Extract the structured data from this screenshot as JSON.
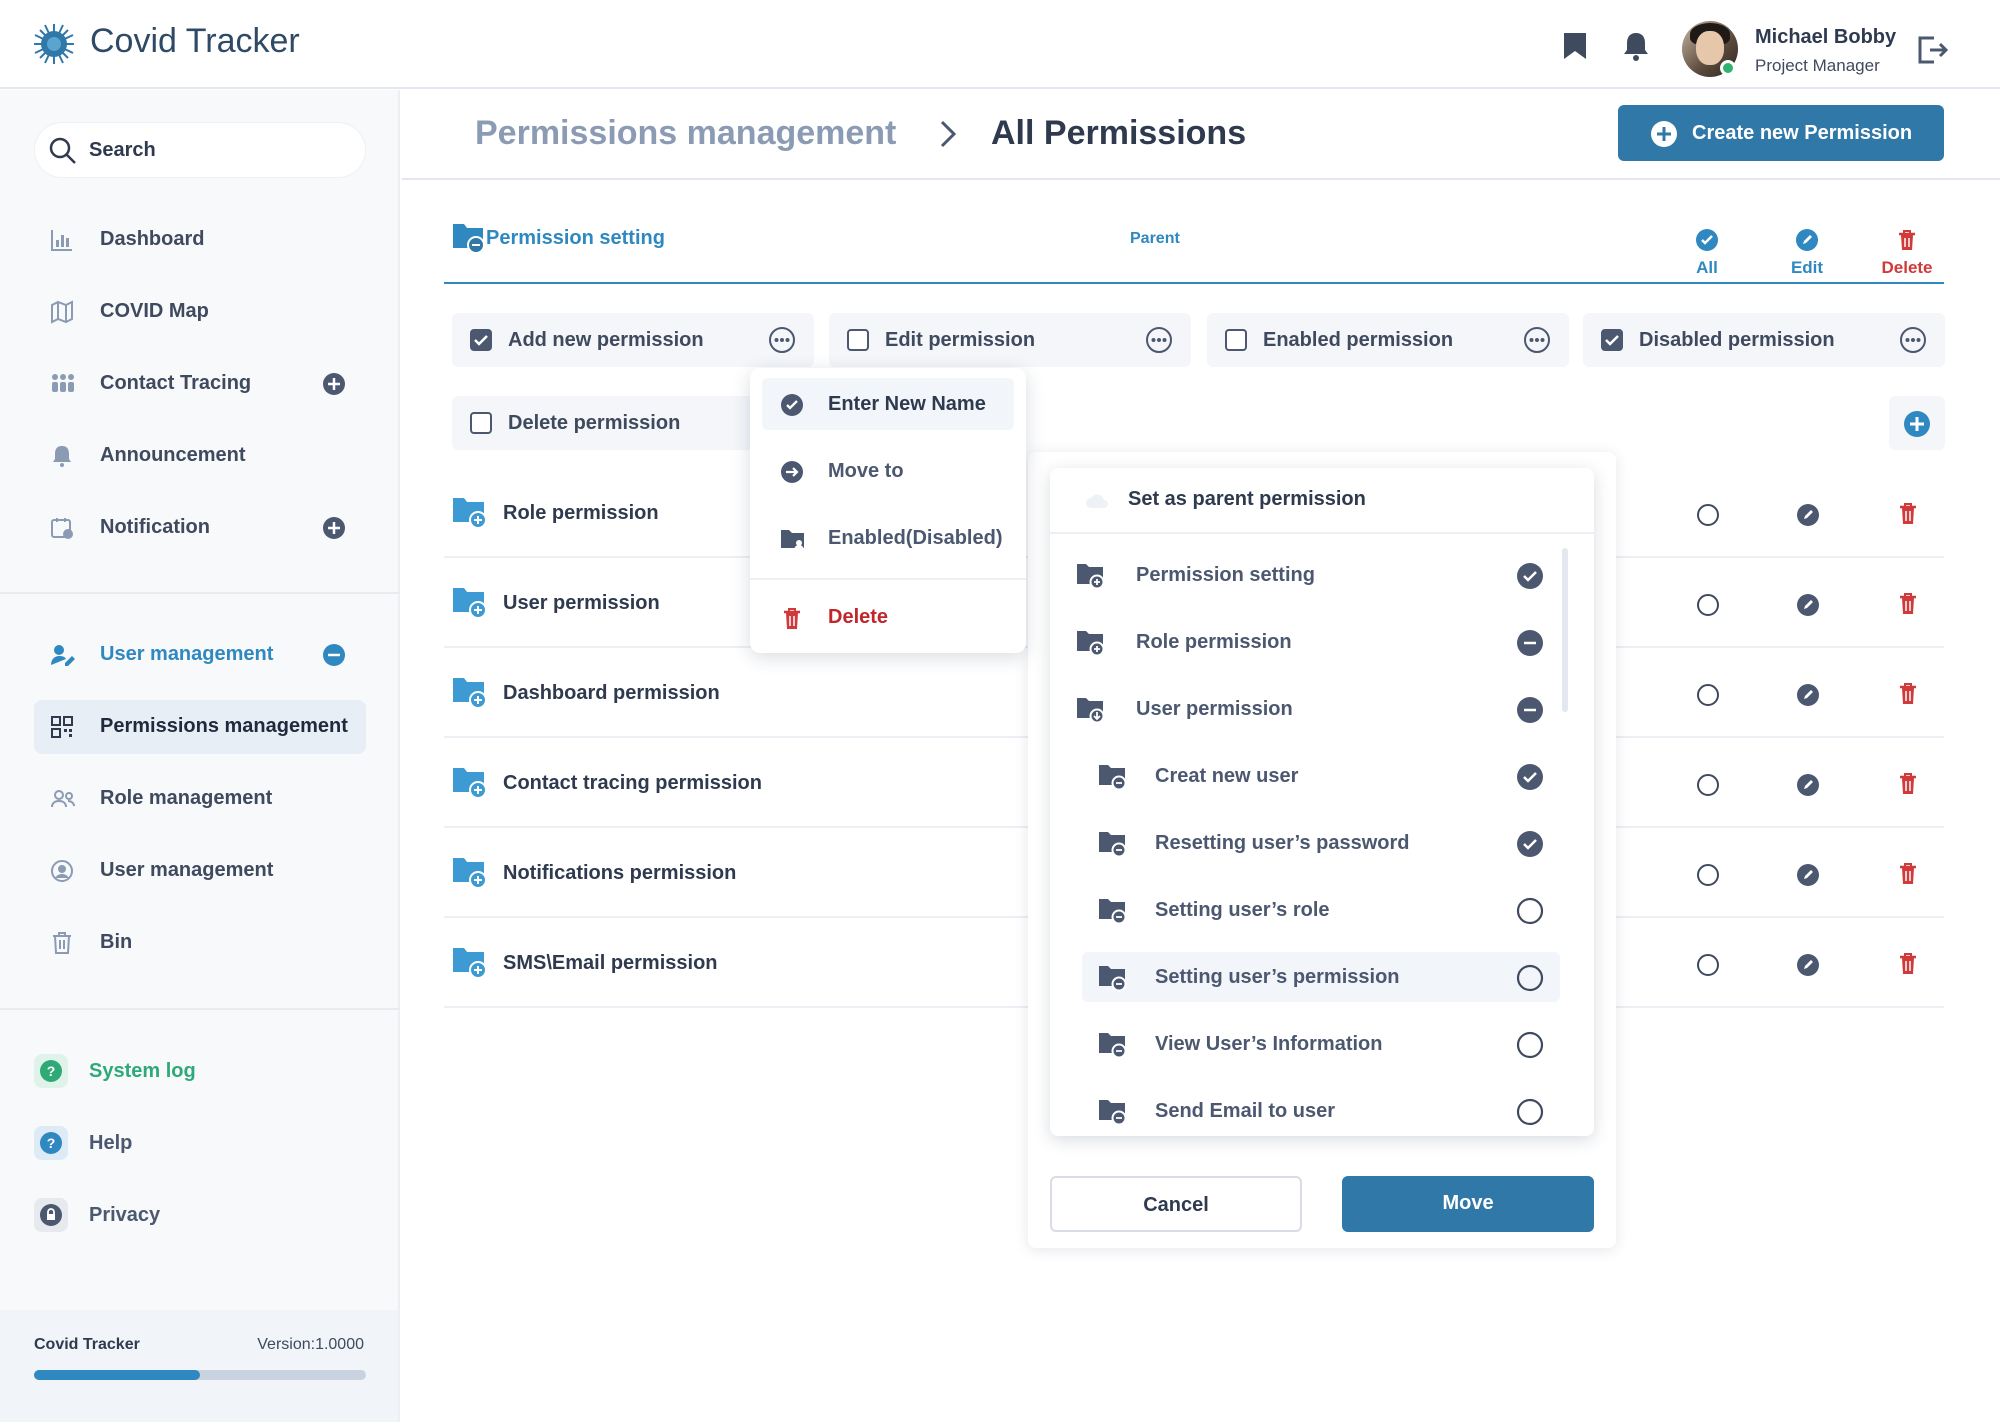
{
  "header": {
    "app_title": "Covid Tracker",
    "user_name": "Michael Bobby",
    "user_role": "Project Manager",
    "icons": [
      "virus-logo-icon",
      "bookmark-icon",
      "bell-icon",
      "logout-icon"
    ]
  },
  "sidebar": {
    "search_label": "Search",
    "items": [
      {
        "label": "Dashboard"
      },
      {
        "label": "COVID Map"
      },
      {
        "label": "Contact Tracing"
      },
      {
        "label": "Announcement"
      },
      {
        "label": "Notification"
      },
      {
        "label": "User management"
      },
      {
        "label": "Permissions management"
      },
      {
        "label": "Role management"
      },
      {
        "label": "User management"
      },
      {
        "label": "Bin"
      }
    ],
    "bottom": [
      {
        "label": "System log",
        "color": "#2faa77"
      },
      {
        "label": "Help",
        "color": "#2f88c0"
      },
      {
        "label": "Privacy",
        "color": "#4c5870"
      }
    ],
    "footer": {
      "name": "Covid Tracker",
      "version": "Version:1.0000",
      "progress": 0.5
    }
  },
  "main": {
    "breadcrumb": {
      "parent": "Permissions management",
      "current": "All Permissions"
    },
    "create_button": "Create new Permission",
    "table_header": {
      "title": "Permission setting",
      "parent": "Parent",
      "col_all": "All",
      "col_edit": "Edit",
      "col_delete": "Delete"
    },
    "chips": [
      {
        "label": "Add new permission",
        "checked": true
      },
      {
        "label": "Edit permission",
        "checked": false
      },
      {
        "label": "Enabled permission",
        "checked": false
      },
      {
        "label": "Disabled permission",
        "checked": true
      },
      {
        "label": "Delete permission",
        "checked": false
      }
    ],
    "rows": [
      {
        "label": "Role permission"
      },
      {
        "label": "User permission"
      },
      {
        "label": "Dashboard permission"
      },
      {
        "label": "Contact tracing permission"
      },
      {
        "label": "Notifications permission"
      },
      {
        "label": "SMS\\Email permission"
      }
    ]
  },
  "context_menu": {
    "items": [
      {
        "label": "Enter New Name"
      },
      {
        "label": "Move to"
      },
      {
        "label": "Enabled(Disabled)"
      },
      {
        "label": "Delete"
      }
    ]
  },
  "move_dialog": {
    "title": "Set as parent permission",
    "nodes": [
      {
        "label": "Permission setting",
        "state": "checked"
      },
      {
        "label": "Role permission",
        "state": "minus"
      },
      {
        "label": "User permission",
        "state": "minus"
      },
      {
        "label": "Creat new user",
        "state": "checked"
      },
      {
        "label": "Resetting user’s password",
        "state": "checked"
      },
      {
        "label": "Setting user’s role",
        "state": "empty"
      },
      {
        "label": "Setting user’s permission",
        "state": "empty"
      },
      {
        "label": "View User’s Information",
        "state": "empty"
      },
      {
        "label": "Send Email to user",
        "state": "empty"
      }
    ],
    "cancel": "Cancel",
    "move": "Move"
  },
  "colors": {
    "accent": "#2f88c0",
    "primary_button": "#2f78a8",
    "danger": "#d03a3a",
    "success": "#2faa77"
  }
}
